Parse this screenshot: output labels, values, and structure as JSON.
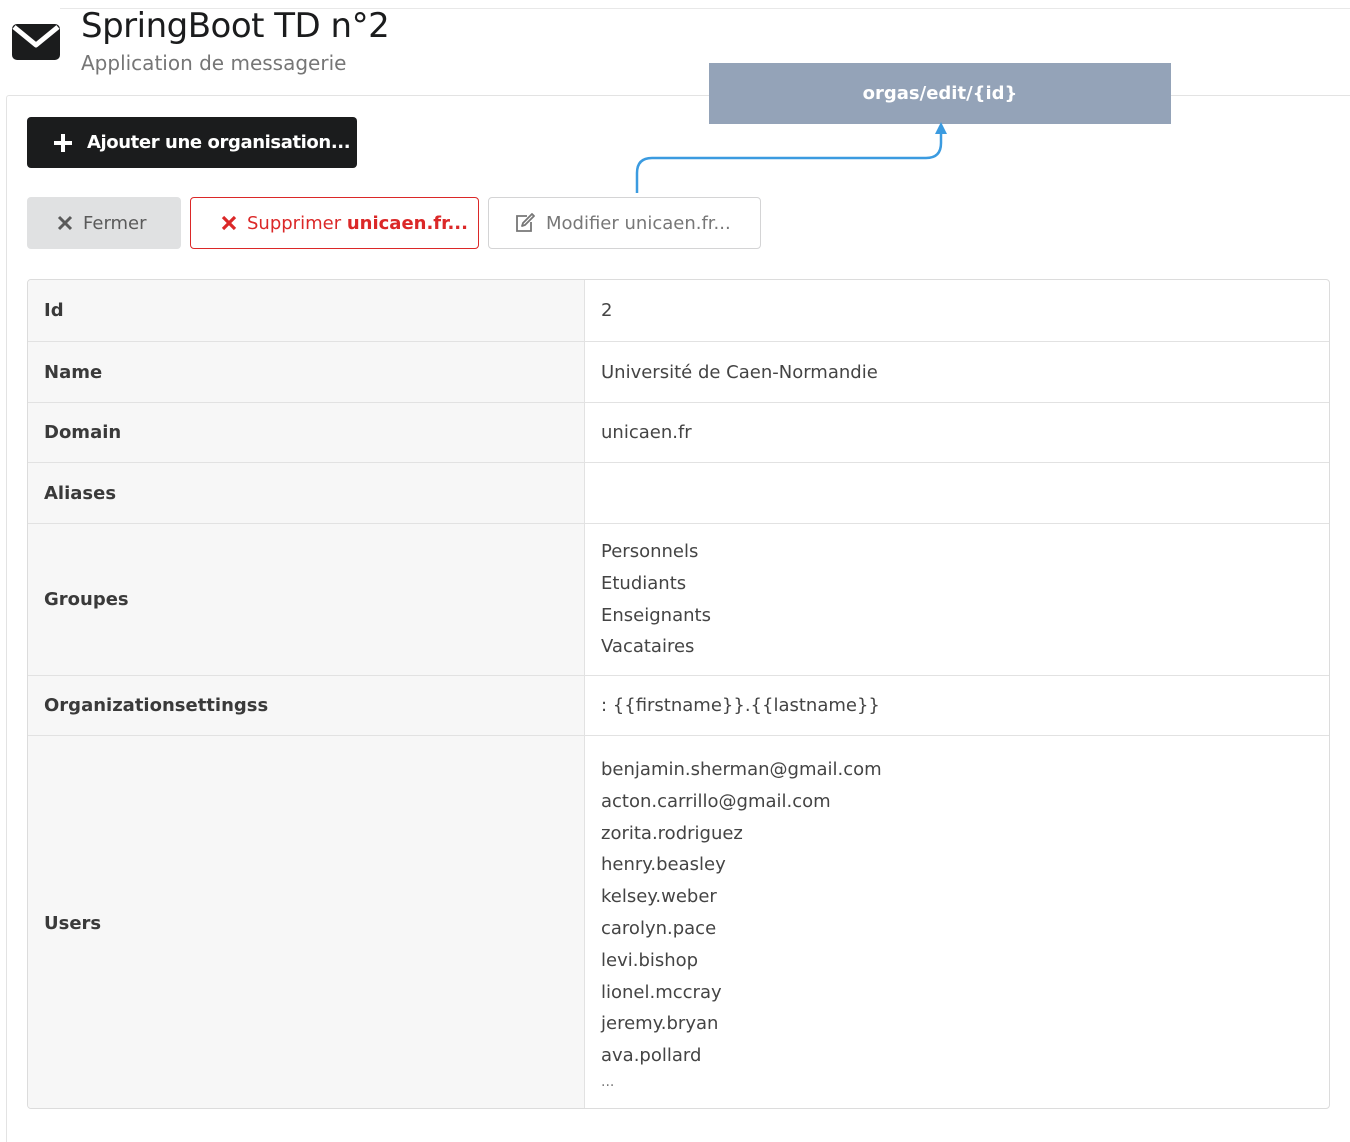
{
  "app": {
    "title": "SpringBoot TD n°2",
    "subtitle": "Application de messagerie"
  },
  "toolbar": {
    "add_label": "Ajouter une organisation..."
  },
  "actions": {
    "close_label": "Fermer",
    "delete_prefix": "Supprimer ",
    "delete_target": "unicaen.fr...",
    "edit_label": "Modifier unicaen.fr..."
  },
  "annotation": {
    "route": "orgas/edit/{id}"
  },
  "details": {
    "id": {
      "label": "Id",
      "value": "2"
    },
    "name": {
      "label": "Name",
      "value": "Université de Caen-Normandie"
    },
    "domain": {
      "label": "Domain",
      "value": "unicaen.fr"
    },
    "aliases": {
      "label": "Aliases",
      "value": ""
    },
    "groupes": {
      "label": "Groupes",
      "items": [
        "Personnels",
        "Etudiants",
        "Enseignants",
        "Vacataires"
      ]
    },
    "settings": {
      "label": "Organizationsettingss",
      "value": ": {{firstname}}.{{lastname}}"
    },
    "users": {
      "label": "Users",
      "items": [
        "benjamin.sherman@gmail.com",
        "acton.carrillo@gmail.com",
        "zorita.rodriguez",
        "henry.beasley",
        "kelsey.weber",
        "carolyn.pace",
        "levi.bishop",
        "lionel.mccray",
        "jeremy.bryan",
        "ava.pollard"
      ],
      "more": "..."
    }
  },
  "colors": {
    "primary_dark": "#1b1c1d",
    "danger": "#db2828",
    "annotation_box": "#94a3b8",
    "annotation_arrow": "#3b9be0"
  },
  "icons": {
    "header": "envelope-icon",
    "add": "plus-icon",
    "close": "close-icon",
    "delete": "close-icon",
    "edit": "edit-icon"
  }
}
